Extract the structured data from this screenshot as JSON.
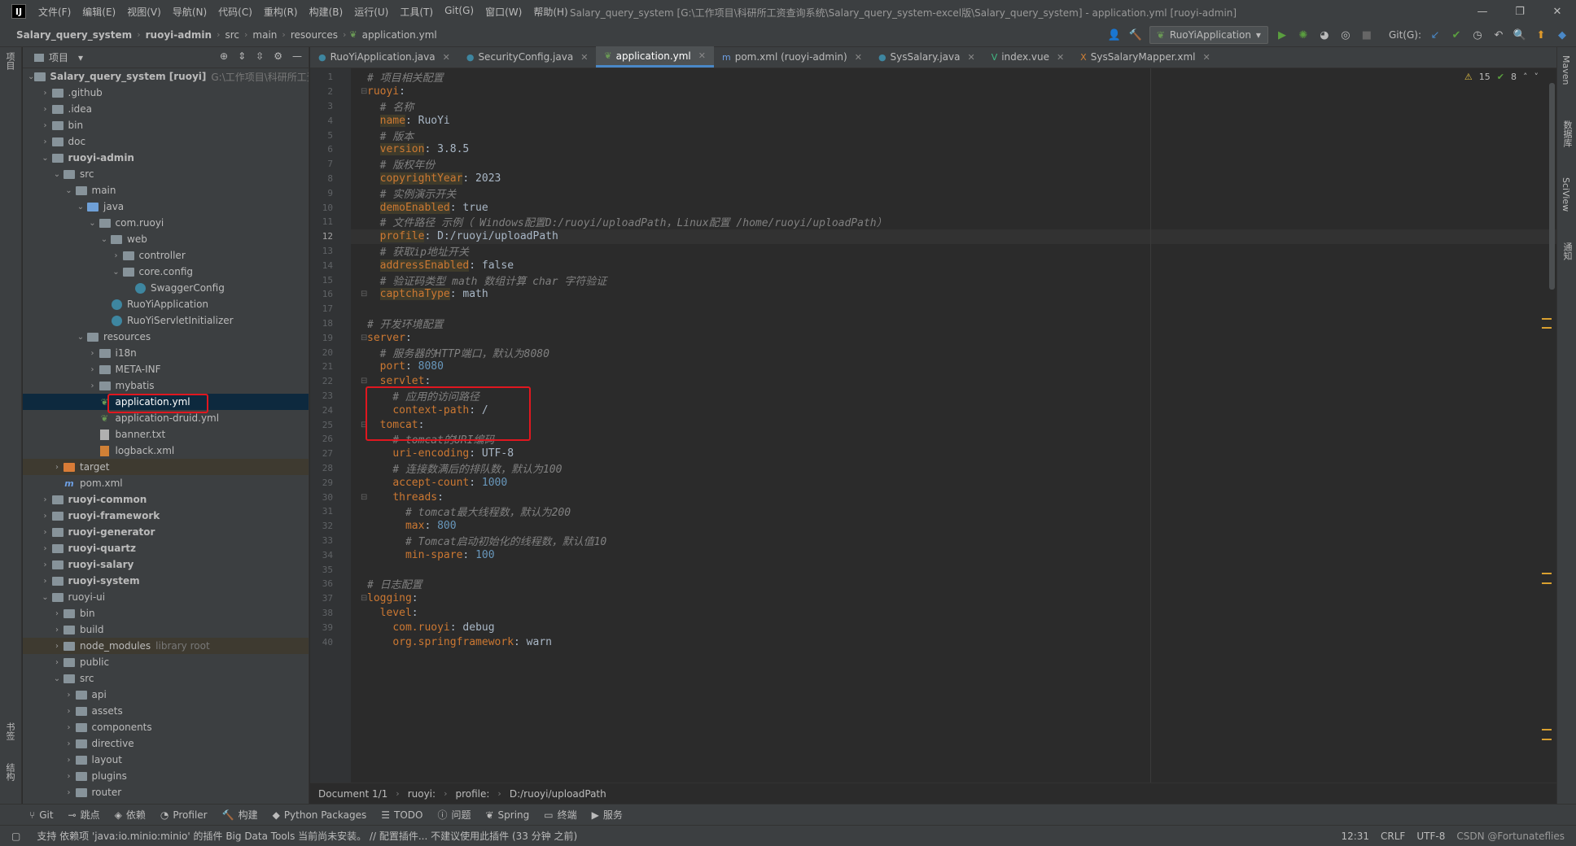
{
  "app": {
    "logo": "IJ",
    "window_title": "Salary_query_system [G:\\工作项目\\科研所工资查询系统\\Salary_query_system-excel版\\Salary_query_system] - application.yml [ruoyi-admin]"
  },
  "menu": [
    "文件(F)",
    "编辑(E)",
    "视图(V)",
    "导航(N)",
    "代码(C)",
    "重构(R)",
    "构建(B)",
    "运行(U)",
    "工具(T)",
    "Git(G)",
    "窗口(W)",
    "帮助(H)"
  ],
  "breadcrumb": [
    "Salary_query_system",
    "ruoyi-admin",
    "src",
    "main",
    "resources",
    "application.yml"
  ],
  "toolbar": {
    "run_config": "RuoYiApplication",
    "git_label": "Git(G):"
  },
  "project_panel": {
    "title": "项目"
  },
  "tree": [
    {
      "depth": 0,
      "arrow": "v",
      "icon": "module",
      "label": "Salary_query_system [ruoyi]",
      "hint": "G:\\工作项目\\科研所工资",
      "bold": true
    },
    {
      "depth": 1,
      "arrow": ">",
      "icon": "folder",
      "label": ".github"
    },
    {
      "depth": 1,
      "arrow": ">",
      "icon": "folder",
      "label": ".idea"
    },
    {
      "depth": 1,
      "arrow": ">",
      "icon": "folder",
      "label": "bin"
    },
    {
      "depth": 1,
      "arrow": ">",
      "icon": "folder",
      "label": "doc"
    },
    {
      "depth": 1,
      "arrow": "v",
      "icon": "module",
      "label": "ruoyi-admin",
      "bold": true
    },
    {
      "depth": 2,
      "arrow": "v",
      "icon": "folder",
      "label": "src"
    },
    {
      "depth": 3,
      "arrow": "v",
      "icon": "folder",
      "label": "main"
    },
    {
      "depth": 4,
      "arrow": "v",
      "icon": "folder-blue",
      "label": "java"
    },
    {
      "depth": 5,
      "arrow": "v",
      "icon": "folder",
      "label": "com.ruoyi"
    },
    {
      "depth": 6,
      "arrow": "v",
      "icon": "folder",
      "label": "web"
    },
    {
      "depth": 7,
      "arrow": ">",
      "icon": "folder",
      "label": "controller"
    },
    {
      "depth": 7,
      "arrow": "v",
      "icon": "folder",
      "label": "core.config"
    },
    {
      "depth": 8,
      "arrow": "",
      "icon": "class",
      "label": "SwaggerConfig"
    },
    {
      "depth": 6,
      "arrow": "",
      "icon": "class",
      "label": "RuoYiApplication"
    },
    {
      "depth": 6,
      "arrow": "",
      "icon": "class",
      "label": "RuoYiServletInitializer"
    },
    {
      "depth": 4,
      "arrow": "v",
      "icon": "folder",
      "label": "resources"
    },
    {
      "depth": 5,
      "arrow": ">",
      "icon": "folder",
      "label": "i18n"
    },
    {
      "depth": 5,
      "arrow": ">",
      "icon": "folder",
      "label": "META-INF"
    },
    {
      "depth": 5,
      "arrow": ">",
      "icon": "folder",
      "label": "mybatis"
    },
    {
      "depth": 5,
      "arrow": "",
      "icon": "yml",
      "label": "application.yml",
      "selected": true
    },
    {
      "depth": 5,
      "arrow": "",
      "icon": "yml",
      "label": "application-druid.yml"
    },
    {
      "depth": 5,
      "arrow": "",
      "icon": "txt",
      "label": "banner.txt"
    },
    {
      "depth": 5,
      "arrow": "",
      "icon": "xml",
      "label": "logback.xml"
    },
    {
      "depth": 2,
      "arrow": ">",
      "icon": "folder-orange",
      "label": "target",
      "excluded": true
    },
    {
      "depth": 2,
      "arrow": "",
      "icon": "m",
      "label": "pom.xml"
    },
    {
      "depth": 1,
      "arrow": ">",
      "icon": "module",
      "label": "ruoyi-common",
      "bold": true
    },
    {
      "depth": 1,
      "arrow": ">",
      "icon": "module",
      "label": "ruoyi-framework",
      "bold": true
    },
    {
      "depth": 1,
      "arrow": ">",
      "icon": "module",
      "label": "ruoyi-generator",
      "bold": true
    },
    {
      "depth": 1,
      "arrow": ">",
      "icon": "module",
      "label": "ruoyi-quartz",
      "bold": true
    },
    {
      "depth": 1,
      "arrow": ">",
      "icon": "module",
      "label": "ruoyi-salary",
      "bold": true
    },
    {
      "depth": 1,
      "arrow": ">",
      "icon": "module",
      "label": "ruoyi-system",
      "bold": true
    },
    {
      "depth": 1,
      "arrow": "v",
      "icon": "folder",
      "label": "ruoyi-ui"
    },
    {
      "depth": 2,
      "arrow": ">",
      "icon": "folder",
      "label": "bin"
    },
    {
      "depth": 2,
      "arrow": ">",
      "icon": "folder",
      "label": "build"
    },
    {
      "depth": 2,
      "arrow": ">",
      "icon": "folder",
      "label": "node_modules",
      "hint": "library root",
      "excluded": true
    },
    {
      "depth": 2,
      "arrow": ">",
      "icon": "folder",
      "label": "public"
    },
    {
      "depth": 2,
      "arrow": "v",
      "icon": "folder",
      "label": "src"
    },
    {
      "depth": 3,
      "arrow": ">",
      "icon": "folder",
      "label": "api"
    },
    {
      "depth": 3,
      "arrow": ">",
      "icon": "folder",
      "label": "assets"
    },
    {
      "depth": 3,
      "arrow": ">",
      "icon": "folder",
      "label": "components"
    },
    {
      "depth": 3,
      "arrow": ">",
      "icon": "folder",
      "label": "directive"
    },
    {
      "depth": 3,
      "arrow": ">",
      "icon": "folder",
      "label": "layout"
    },
    {
      "depth": 3,
      "arrow": ">",
      "icon": "folder",
      "label": "plugins"
    },
    {
      "depth": 3,
      "arrow": ">",
      "icon": "folder",
      "label": "router"
    }
  ],
  "tabs": [
    {
      "icon": "C",
      "label": "RuoYiApplication.java"
    },
    {
      "icon": "C",
      "label": "SecurityConfig.java"
    },
    {
      "icon": "Y",
      "label": "application.yml",
      "active": true
    },
    {
      "icon": "m",
      "label": "pom.xml (ruoyi-admin)"
    },
    {
      "icon": "C",
      "label": "SysSalary.java"
    },
    {
      "icon": "V",
      "label": "index.vue"
    },
    {
      "icon": "X",
      "label": "SysSalaryMapper.xml"
    }
  ],
  "inspections": {
    "warnings": "15",
    "ok": "8"
  },
  "code_lines": [
    [
      {
        "t": "# 项目相关配置",
        "c": "cmt"
      }
    ],
    [
      {
        "t": "ruoyi",
        "c": "key"
      },
      {
        "t": ":",
        "c": "val"
      }
    ],
    [
      {
        "t": "  # 名称",
        "c": "cmt"
      }
    ],
    [
      {
        "t": "  "
      },
      {
        "t": "name",
        "c": "keybg"
      },
      {
        "t": ": RuoYi",
        "c": "val"
      }
    ],
    [
      {
        "t": "  # 版本",
        "c": "cmt"
      }
    ],
    [
      {
        "t": "  "
      },
      {
        "t": "version",
        "c": "keybg"
      },
      {
        "t": ": 3.8.5",
        "c": "val"
      }
    ],
    [
      {
        "t": "  # 版权年份",
        "c": "cmt"
      }
    ],
    [
      {
        "t": "  "
      },
      {
        "t": "copyrightYear",
        "c": "keybg"
      },
      {
        "t": ": 2023",
        "c": "val"
      }
    ],
    [
      {
        "t": "  # 实例演示开关",
        "c": "cmt"
      }
    ],
    [
      {
        "t": "  "
      },
      {
        "t": "demoEnabled",
        "c": "keybg"
      },
      {
        "t": ": true",
        "c": "val"
      }
    ],
    [
      {
        "t": "  # 文件路径 示例（ Windows配置D:/ruoyi/uploadPath，Linux配置 /home/ruoyi/uploadPath）",
        "c": "cmt"
      }
    ],
    [
      {
        "t": "  "
      },
      {
        "t": "profile",
        "c": "keybg"
      },
      {
        "t": ": D:/ruoyi/uploadPath",
        "c": "val"
      }
    ],
    [
      {
        "t": "  # 获取ip地址开关",
        "c": "cmt"
      }
    ],
    [
      {
        "t": "  "
      },
      {
        "t": "addressEnabled",
        "c": "keybg"
      },
      {
        "t": ": false",
        "c": "val"
      }
    ],
    [
      {
        "t": "  # 验证码类型 math 数组计算 char 字符验证",
        "c": "cmt"
      }
    ],
    [
      {
        "t": "  "
      },
      {
        "t": "captchaType",
        "c": "keybg"
      },
      {
        "t": ": math",
        "c": "val"
      }
    ],
    [],
    [
      {
        "t": "# 开发环境配置",
        "c": "cmt"
      }
    ],
    [
      {
        "t": "server",
        "c": "key"
      },
      {
        "t": ":",
        "c": "val"
      }
    ],
    [
      {
        "t": "  # 服务器的HTTP端口，默认为8080",
        "c": "cmt"
      }
    ],
    [
      {
        "t": "  "
      },
      {
        "t": "port",
        "c": "key"
      },
      {
        "t": ": ",
        "c": "val"
      },
      {
        "t": "8080",
        "c": "num"
      }
    ],
    [
      {
        "t": "  "
      },
      {
        "t": "servlet",
        "c": "key"
      },
      {
        "t": ":",
        "c": "val"
      }
    ],
    [
      {
        "t": "    # 应用的访问路径",
        "c": "cmt"
      }
    ],
    [
      {
        "t": "    "
      },
      {
        "t": "context-path",
        "c": "key"
      },
      {
        "t": ": /",
        "c": "val"
      }
    ],
    [
      {
        "t": "  "
      },
      {
        "t": "tomcat",
        "c": "key"
      },
      {
        "t": ":",
        "c": "val"
      }
    ],
    [
      {
        "t": "    # tomcat的URI编码",
        "c": "cmt"
      }
    ],
    [
      {
        "t": "    "
      },
      {
        "t": "uri-encoding",
        "c": "key"
      },
      {
        "t": ": UTF-8",
        "c": "val"
      }
    ],
    [
      {
        "t": "    # 连接数满后的排队数，默认为100",
        "c": "cmt"
      }
    ],
    [
      {
        "t": "    "
      },
      {
        "t": "accept-count",
        "c": "key"
      },
      {
        "t": ": ",
        "c": "val"
      },
      {
        "t": "1000",
        "c": "num"
      }
    ],
    [
      {
        "t": "    "
      },
      {
        "t": "threads",
        "c": "key"
      },
      {
        "t": ":",
        "c": "val"
      }
    ],
    [
      {
        "t": "      # tomcat最大线程数，默认为200",
        "c": "cmt"
      }
    ],
    [
      {
        "t": "      "
      },
      {
        "t": "max",
        "c": "key"
      },
      {
        "t": ": ",
        "c": "val"
      },
      {
        "t": "800",
        "c": "num"
      }
    ],
    [
      {
        "t": "      # Tomcat启动初始化的线程数，默认值10",
        "c": "cmt"
      }
    ],
    [
      {
        "t": "      "
      },
      {
        "t": "min-spare",
        "c": "key"
      },
      {
        "t": ": ",
        "c": "val"
      },
      {
        "t": "100",
        "c": "num"
      }
    ],
    [],
    [
      {
        "t": "# 日志配置",
        "c": "cmt"
      }
    ],
    [
      {
        "t": "logging",
        "c": "key"
      },
      {
        "t": ":",
        "c": "val"
      }
    ],
    [
      {
        "t": "  "
      },
      {
        "t": "level",
        "c": "key"
      },
      {
        "t": ":",
        "c": "val"
      }
    ],
    [
      {
        "t": "    "
      },
      {
        "t": "com.ruoyi",
        "c": "key"
      },
      {
        "t": ": debug",
        "c": "val"
      }
    ],
    [
      {
        "t": "    "
      },
      {
        "t": "org.springframework",
        "c": "key"
      },
      {
        "t": ": warn",
        "c": "val"
      }
    ]
  ],
  "editor_breadcrumb": [
    "Document 1/1",
    "ruoyi:",
    "profile:",
    "D:/ruoyi/uploadPath"
  ],
  "tool_windows": [
    "Git",
    "跳点",
    "依赖",
    "Profiler",
    "构建",
    "Python Packages",
    "TODO",
    "问题",
    "Spring",
    "终端",
    "服务"
  ],
  "status": {
    "message": "支持 依赖项 'java:io.minio:minio' 的插件 Big Data Tools 当前尚未安装。 // 配置插件...  不建议使用此插件 (33 分钟 之前)",
    "position": "12:31",
    "line_sep": "CRLF",
    "encoding": "UTF-8",
    "watermark": "CSDN @Fortunateflies"
  },
  "side_strips": {
    "left_top": "项目",
    "left_bottom": "书签",
    "left_bottom2": "结构",
    "right": [
      "Maven",
      "数据库",
      "SciView",
      "通知"
    ]
  }
}
